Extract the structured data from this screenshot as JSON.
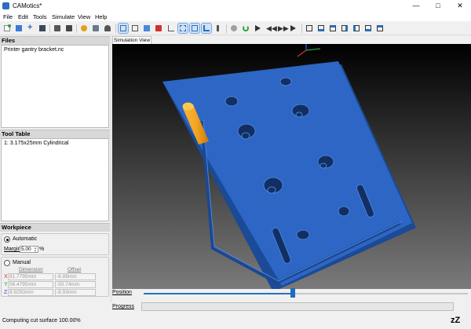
{
  "window": {
    "title": "CAMotics*"
  },
  "menu": [
    "File",
    "Edit",
    "Tools",
    "Simulate",
    "View",
    "Help"
  ],
  "panels": {
    "files": {
      "header": "Files",
      "items": [
        "Printer gantry bracket.nc"
      ]
    },
    "tool_table": {
      "header": "Tool Table",
      "items": [
        "1: 3.175x25mm Cylindrical"
      ]
    },
    "workpiece": {
      "header": "Workpiece",
      "automatic": {
        "label": "Automatic",
        "selected": true,
        "margin_label": "Margin",
        "margin_value": "5.00",
        "margin_unit": "%"
      },
      "manual": {
        "label": "Manual",
        "selected": false,
        "dimension_header": "Dimension",
        "offset_header": "Offset",
        "rows": [
          {
            "axis": "X",
            "dimension": "81.7795mm",
            "offset": "-6.89mm",
            "axis_color": "#e03030"
          },
          {
            "axis": "Y",
            "dimension": "56.4795mm",
            "offset": "-50.74mm",
            "axis_color": "#30a030"
          },
          {
            "axis": "Z",
            "dimension": "8.9250mm",
            "offset": "-8.93mm",
            "axis_color": "#3050e0"
          }
        ]
      }
    }
  },
  "sim": {
    "tab": "Simulation View",
    "background_top": "#000000",
    "background_bottom": "#7a7a7a",
    "workpiece_color": "#2d66c4",
    "tool_color": "#f5a623"
  },
  "position": {
    "label": "Position",
    "value_fraction": 0.46
  },
  "progress": {
    "label": "Progress",
    "value_fraction": 0
  },
  "status": {
    "text": "Computing cut surface 100.00%",
    "sleep_icon": "zZ"
  }
}
